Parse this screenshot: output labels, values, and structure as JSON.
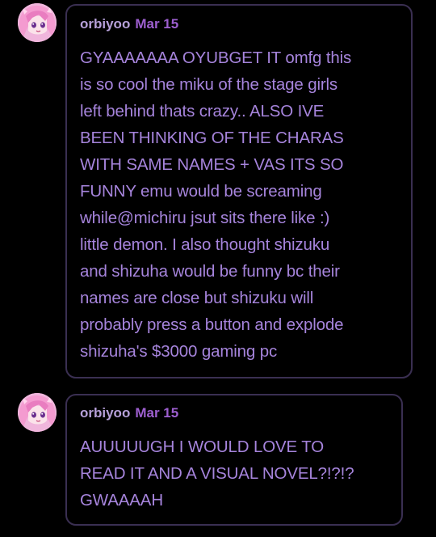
{
  "comments": [
    {
      "username": "orbiyoo",
      "date": "Mar 15",
      "avatar_icon": "anime-girl-avatar-icon",
      "body_lines": [
        "GYAAAAAAA OYUBGET IT  omfg this",
        "is so cool the miku of the stage girls",
        "left behind thats crazy.. ALSO IVE",
        "BEEN THINKING OF THE CHARAS",
        "WITH SAME NAMES + VAS ITS SO",
        "FUNNY emu would be screaming",
        "while@michiru jsut sits there like :)",
        "little demon. I also thought shizuku",
        "and shizuha would be funny bc their",
        "names are close but shizuku will",
        "probably press a button and explode",
        "shizuha's $3000 gaming pc"
      ]
    },
    {
      "username": "orbiyoo",
      "date": "Mar 15",
      "avatar_icon": "anime-girl-avatar-icon",
      "body_lines": [
        "AUUUUUGH I WOULD LOVE TO",
        "READ IT AND A VISUAL NOVEL?!?!?",
        "GWAAAAH"
      ]
    }
  ],
  "colors": {
    "background": "#000000",
    "bubble_border": "#3a2f52",
    "username": "#b7a1da",
    "date": "#9d5fcf",
    "body_text": "#a684dc"
  }
}
